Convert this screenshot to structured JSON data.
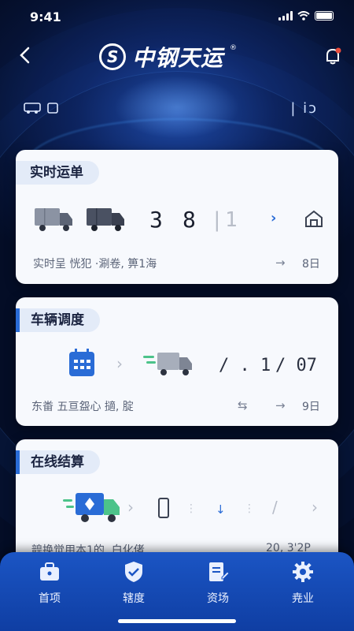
{
  "status_bar": {
    "time": "9:41"
  },
  "header": {
    "brand": "中钢天运",
    "registered": "®"
  },
  "sub_row": {
    "right_mark": "| ı̇ɔ"
  },
  "cards": [
    {
      "title": "实时运单",
      "count_a": "3",
      "count_b": "8",
      "count_c": "1",
      "desc": "实时呈 恍犯 ·涮卷, 箅1海",
      "meta_right": "8日"
    },
    {
      "title": "车辆调度",
      "value_a": "/ . 1",
      "value_b": "/ 07",
      "desc": "东畨 五亘盌心 擿, 腚",
      "meta_right": "9日"
    },
    {
      "title": "在线结算",
      "desc": "韹换觉用本1的, 白化偖",
      "meta_right": "20, 3'2P"
    }
  ],
  "tabs": [
    {
      "label": "首项",
      "icon": "briefcase-icon"
    },
    {
      "label": "辖度",
      "icon": "shield-check-icon"
    },
    {
      "label": "资场",
      "icon": "document-edit-icon"
    },
    {
      "label": "尭业",
      "icon": "gear-icon"
    }
  ],
  "colors": {
    "accent": "#2a6cd6",
    "tabbar": "#1b55c4",
    "background": "#06122e"
  }
}
